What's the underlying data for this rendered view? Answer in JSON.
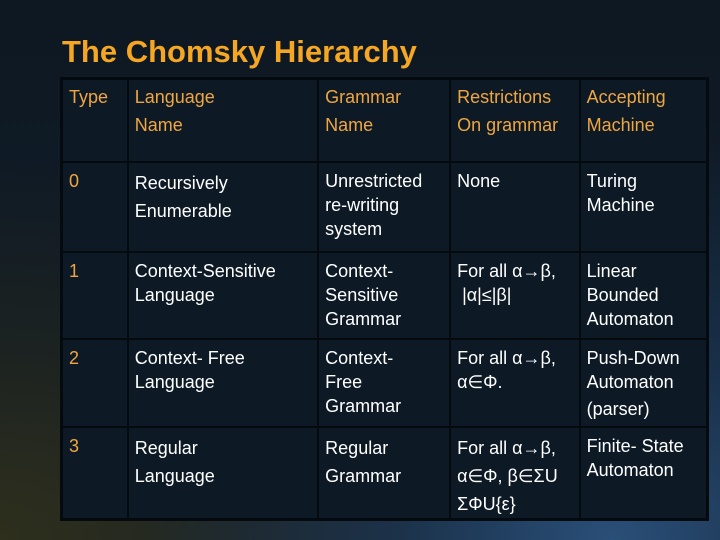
{
  "title": "The Chomsky Hierarchy",
  "table": {
    "headers": [
      [
        "Type"
      ],
      [
        "Language",
        "Name"
      ],
      [
        "Grammar",
        "Name"
      ],
      [
        "Restrictions",
        "On grammar"
      ],
      [
        "Accepting",
        "Machine"
      ]
    ],
    "rows": [
      {
        "type": "0",
        "language": [
          "Recursively",
          "Enumerable"
        ],
        "grammar": [
          "Unrestricted",
          "re-writing",
          "system"
        ],
        "restrictions": [
          "None"
        ],
        "machine": [
          "Turing",
          "Machine"
        ]
      },
      {
        "type": "1",
        "language": [
          "Context-Sensitive",
          "Language"
        ],
        "grammar": [
          "Context-",
          "Sensitive",
          "Grammar"
        ],
        "restrictions": [
          "For all α→β,",
          " |α|≤|β|"
        ],
        "machine": [
          "Linear",
          "Bounded",
          "Automaton"
        ]
      },
      {
        "type": "2",
        "language": [
          "Context- Free",
          "Language"
        ],
        "grammar": [
          "Context-",
          "Free",
          "Grammar"
        ],
        "restrictions": [
          "For all α→β,",
          "α∈Φ."
        ],
        "machine": [
          "Push-Down",
          "Automaton",
          "(parser)"
        ]
      },
      {
        "type": "3",
        "language": [
          "Regular",
          "Language"
        ],
        "grammar": [
          "Regular",
          "Grammar"
        ],
        "restrictions": [
          "For all α→β,",
          "α∈Φ, β∈ΣU",
          "ΣΦU{ε}"
        ],
        "machine": [
          "Finite- State",
          "Automaton"
        ]
      }
    ]
  },
  "colors": {
    "title": "#f5a623",
    "header_text": "#f0a640",
    "body_text": "#ffffff",
    "cell_bg": "#0d1a26",
    "border": "#050a0f"
  }
}
